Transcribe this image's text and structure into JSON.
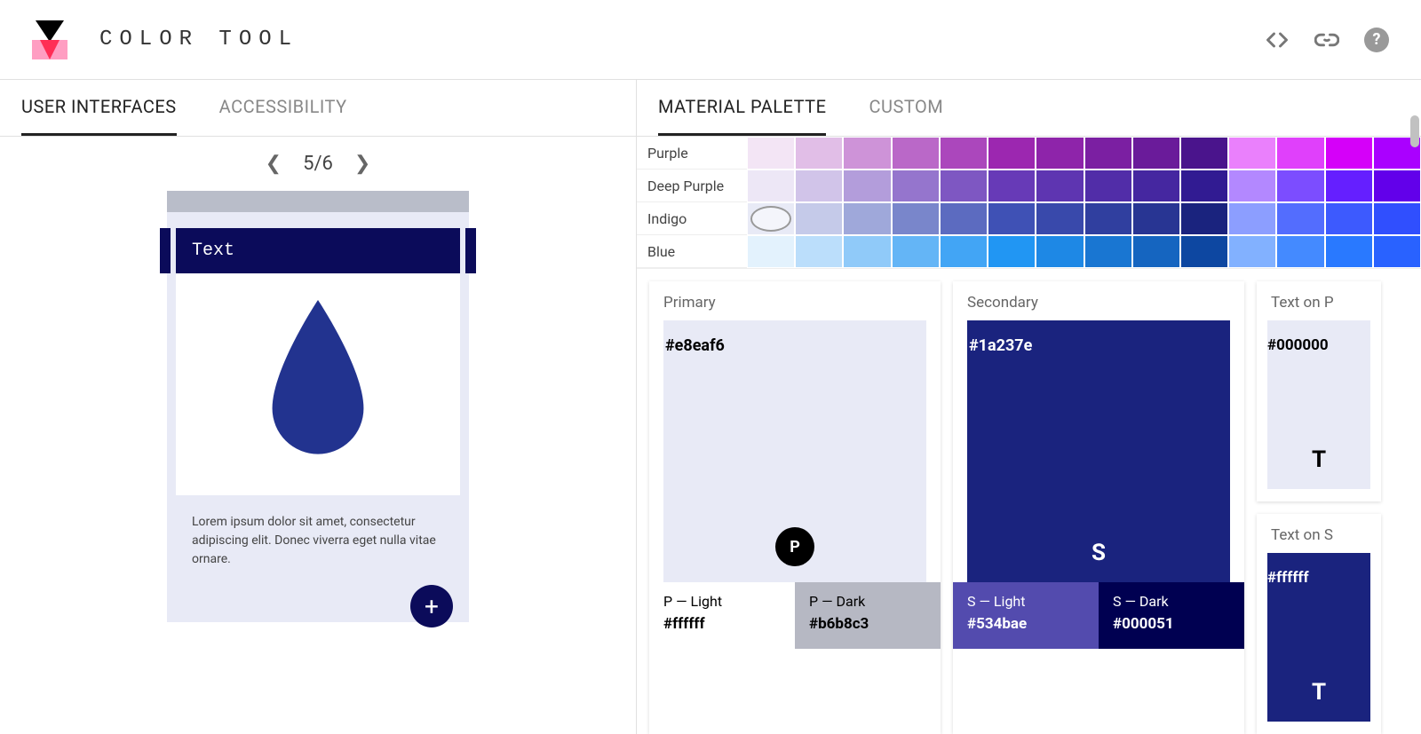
{
  "header": {
    "title": "COLOR TOOL",
    "icons": {
      "code": "code-icon",
      "link": "link-icon",
      "help": "?"
    }
  },
  "left": {
    "tabs": {
      "ui": "USER INTERFACES",
      "a11y": "ACCESSIBILITY"
    },
    "pager": {
      "current": "5/6"
    },
    "preview": {
      "title": "Text",
      "body": "Lorem ipsum dolor sit amet, consectetur adipiscing elit. Donec viverra eget nulla vitae ornare."
    }
  },
  "right": {
    "tabs": {
      "material": "MATERIAL PALETTE",
      "custom": "CUSTOM"
    },
    "palette_rows": [
      {
        "name": "Purple",
        "colors": [
          "#f3e5f5",
          "#e1bee7",
          "#ce93d8",
          "#ba68c8",
          "#ab47bc",
          "#9c27b0",
          "#8e24aa",
          "#7b1fa2",
          "#6a1b9a",
          "#4a148c",
          "#ea80fc",
          "#e040fb",
          "#d500f9",
          "#aa00ff"
        ]
      },
      {
        "name": "Deep Purple",
        "colors": [
          "#ede7f6",
          "#d1c4e9",
          "#b39ddb",
          "#9575cd",
          "#7e57c2",
          "#673ab7",
          "#5e35b1",
          "#512da8",
          "#4527a0",
          "#311b92",
          "#b388ff",
          "#7c4dff",
          "#651fff",
          "#6200ea"
        ]
      },
      {
        "name": "Indigo",
        "colors": [
          "#e8eaf6",
          "#c5cae9",
          "#9fa8da",
          "#7986cb",
          "#5c6bc0",
          "#3f51b5",
          "#3949ab",
          "#303f9f",
          "#283593",
          "#1a237e",
          "#8c9eff",
          "#536dfe",
          "#3d5afe",
          "#304ffe"
        ]
      },
      {
        "name": "Blue",
        "colors": [
          "#e3f2fd",
          "#bbdefb",
          "#90caf9",
          "#64b5f6",
          "#42a5f5",
          "#2196f3",
          "#1e88e5",
          "#1976d2",
          "#1565c0",
          "#0d47a1",
          "#82b1ff",
          "#448aff",
          "#2979ff",
          "#2962ff"
        ]
      }
    ],
    "selected": {
      "row": 2,
      "col": 0
    },
    "primary": {
      "label": "Primary",
      "hex": "#e8eaf6",
      "swatch": "#e8eaf6",
      "badgeBg": "#000",
      "badgeFg": "#fff",
      "badge": "P",
      "light": {
        "label": "P — Light",
        "hex": "#ffffff",
        "bg": "#ffffff",
        "fg": "#000"
      },
      "dark": {
        "label": "P — Dark",
        "hex": "#b6b8c3",
        "bg": "#b6b8c3",
        "fg": "#000"
      }
    },
    "secondary": {
      "label": "Secondary",
      "hex": "#1a237e",
      "swatch": "#1a237e",
      "badgeFg": "#fff",
      "badge": "S",
      "light": {
        "label": "S — Light",
        "hex": "#534bae",
        "bg": "#534bae",
        "fg": "#fff"
      },
      "dark": {
        "label": "S — Dark",
        "hex": "#000051",
        "bg": "#000051",
        "fg": "#fff"
      }
    },
    "textOnP": {
      "label": "Text on P",
      "hex": "#000000",
      "bg": "#e8eaf6",
      "fg": "#000",
      "char": "T"
    },
    "textOnS": {
      "label": "Text on S",
      "hex": "#ffffff",
      "bg": "#1a237e",
      "fg": "#fff",
      "char": "T"
    }
  }
}
